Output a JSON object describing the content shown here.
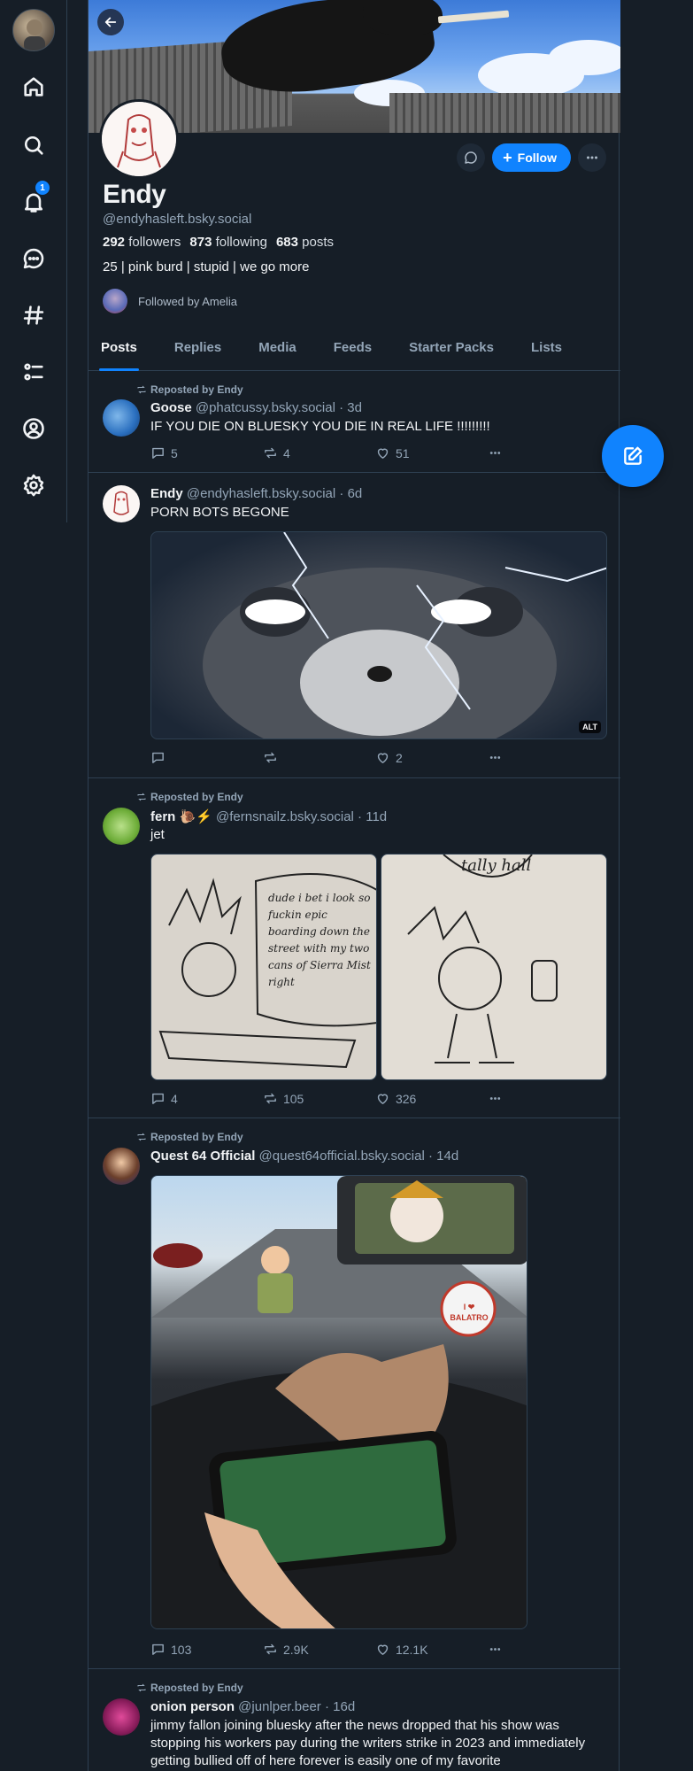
{
  "nav": {
    "notification_count": "1",
    "items": [
      "home-icon",
      "search-icon",
      "notifications-icon",
      "chat-icon",
      "feeds-icon",
      "lists-icon",
      "profile-icon",
      "settings-icon"
    ]
  },
  "profile": {
    "display_name": "Endy",
    "handle": "@endyhasleft.bsky.social",
    "followers_count": "292",
    "followers_label": "followers",
    "following_count": "873",
    "following_label": "following",
    "posts_count": "683",
    "posts_label": "posts",
    "bio": "25 | pink burd | stupid | we go more",
    "followed_by": "Followed by Amelia",
    "follow_label": "Follow"
  },
  "tabs": [
    "Posts",
    "Replies",
    "Media",
    "Feeds",
    "Starter Packs",
    "Lists"
  ],
  "posts": [
    {
      "repost": "Reposted by Endy",
      "name": "Goose",
      "handle": "@phatcussy.bsky.social",
      "time": "· 3d",
      "text": "IF YOU DIE ON BLUESKY YOU DIE IN REAL LIFE !!!!!!!!!",
      "replies": "5",
      "reposts": "4",
      "likes": "51"
    },
    {
      "repost": "",
      "name": "Endy",
      "handle": "@endyhasleft.bsky.social",
      "time": "· 6d",
      "text": "PORN BOTS BEGONE",
      "alt": "ALT",
      "replies": "",
      "reposts": "",
      "likes": "2"
    },
    {
      "repost": "Reposted by Endy",
      "name": "fern 🐌⚡",
      "handle": "@fernsnailz.bsky.social",
      "time": "· 11d",
      "text": "jet",
      "drawing_text_left": "dude i bet i look so fuckin epic boarding down the street with my two cans of Sierra Mist right",
      "drawing_text_right": "tally hall",
      "replies": "4",
      "reposts": "105",
      "likes": "326"
    },
    {
      "repost": "Reposted by Endy",
      "name": "Quest 64 Official",
      "handle": "@quest64official.bsky.social",
      "time": "· 14d",
      "text": "",
      "sticker_text": "I ❤ BALATRO",
      "replies": "103",
      "reposts": "2.9K",
      "likes": "12.1K"
    },
    {
      "repost": "Reposted by Endy",
      "name": "onion person",
      "handle": "@junlper.beer",
      "time": "· 16d",
      "text": "jimmy fallon joining bluesky after the news dropped that his show was stopping his workers pay during the writers strike in 2023 and immediately getting bullied off of here forever is easily one of my favorite"
    }
  ],
  "colors": {
    "accent": "#1083fe",
    "background": "#161e27",
    "border": "#2e4052",
    "muted": "#93a5b7"
  }
}
